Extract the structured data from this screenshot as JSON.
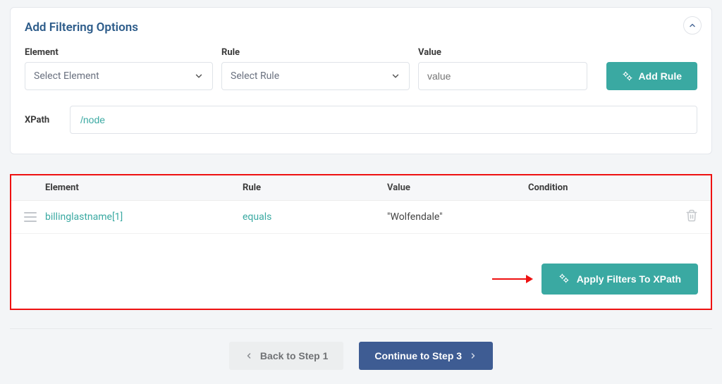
{
  "panel": {
    "title": "Add Filtering Options",
    "labels": {
      "element": "Element",
      "rule": "Rule",
      "value": "Value",
      "xpath": "XPath"
    },
    "placeholders": {
      "select_element": "Select Element",
      "select_rule": "Select Rule",
      "value": "value"
    },
    "xpath_value": "/node",
    "add_rule": "Add Rule"
  },
  "table": {
    "headers": {
      "element": "Element",
      "rule": "Rule",
      "value": "Value",
      "condition": "Condition"
    },
    "rows": [
      {
        "element": "billinglastname[1]",
        "rule": "equals",
        "value": "\"Wolfendale\"",
        "condition": ""
      }
    ]
  },
  "apply_label": "Apply Filters To XPath",
  "nav": {
    "back": "Back to Step 1",
    "continue": "Continue to Step 3"
  }
}
